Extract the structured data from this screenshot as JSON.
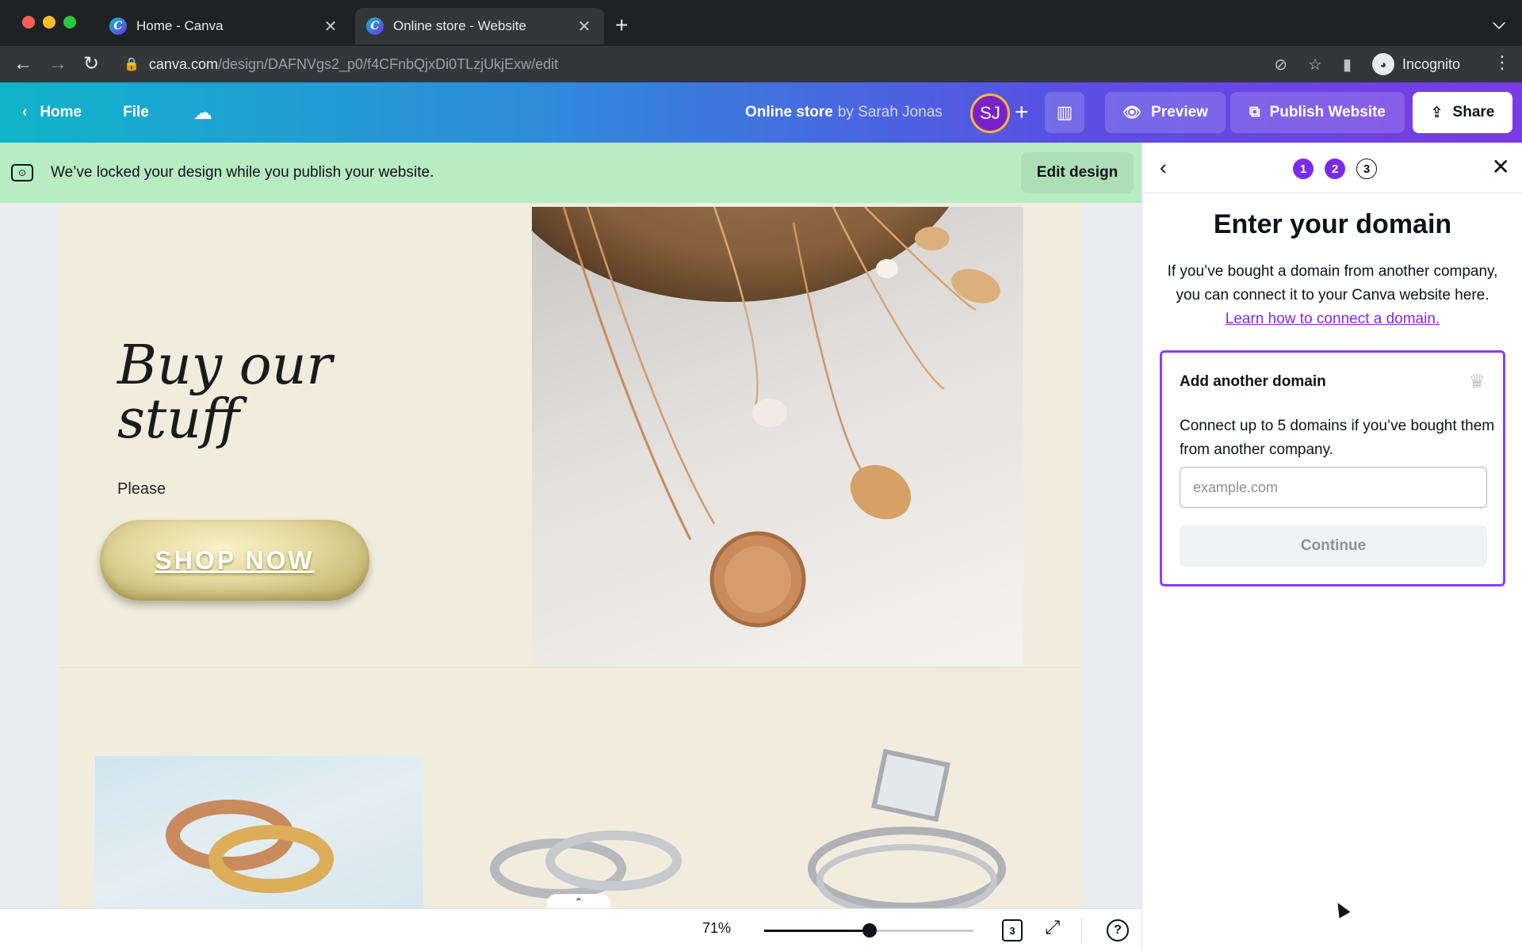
{
  "browser": {
    "tabs": [
      {
        "title": "Home - Canva",
        "active": false
      },
      {
        "title": "Online store - Website",
        "active": true
      }
    ],
    "url_host": "canva.com",
    "url_path": "/design/DAFNVgs2_p0/f4CFnbQjxDi0TLzjUkjExw/edit",
    "profile_label": "Incognito"
  },
  "header": {
    "home_label": "Home",
    "file_label": "File",
    "design_title": "Online store",
    "design_owner": "by Sarah Jonas",
    "avatar_initials": "SJ",
    "preview_label": "Preview",
    "publish_label": "Publish Website",
    "share_label": "Share"
  },
  "banner": {
    "message": "We’ve locked your design while you publish your website.",
    "edit_label": "Edit design"
  },
  "canvas": {
    "hero_title": "Buy our stuff",
    "hero_sub": "Please",
    "shop_button": "SHOP NOW",
    "expand_glyph": "⌃"
  },
  "bottom_bar": {
    "zoom_label": "71%",
    "zoom_level": 0.71,
    "page_count": "3",
    "help_glyph": "?"
  },
  "panel": {
    "steps": [
      "1",
      "2",
      "3"
    ],
    "current_step": 3,
    "heading": "Enter your domain",
    "description": "If you’ve bought a domain from another company, you can connect it to your Canva website here.",
    "link_text": "Learn how to connect a domain.",
    "card": {
      "title": "Add another domain",
      "description": "Connect up to 5 domains if you’ve bought them from another company.",
      "input_placeholder": "example.com",
      "input_value": "",
      "continue_label": "Continue"
    }
  },
  "colors": {
    "accent": "#7d2ae8",
    "card_border": "#8b3dff",
    "banner_bg": "#b8ecc3",
    "header_gradient_start": "#10b4c9",
    "header_gradient_end": "#7a3ae6"
  },
  "icons": [
    "canva-favicon",
    "close-icon",
    "plus-icon",
    "chevron-down-icon",
    "back-arrow-icon",
    "forward-arrow-icon",
    "reload-icon",
    "lock-icon",
    "eye-off-icon",
    "star-icon",
    "sidebar-icon",
    "incognito-icon",
    "more-vert-icon",
    "chevron-left-icon",
    "cloud-check-icon",
    "bar-chart-icon",
    "eye-icon",
    "publish-icon",
    "share-icon",
    "locked-design-icon",
    "crown-icon",
    "pages-icon",
    "fullscreen-icon",
    "help-icon"
  ]
}
